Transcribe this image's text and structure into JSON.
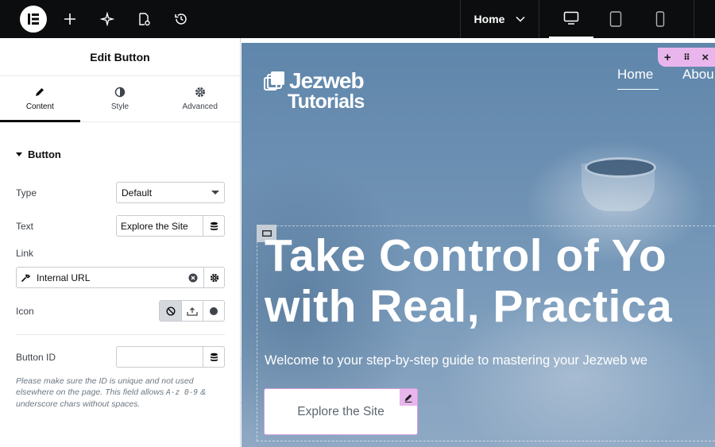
{
  "topbar": {
    "page_select": "Home",
    "icons": [
      "elementor-logo-icon",
      "add-icon",
      "ai-sparkle-icon",
      "page-settings-icon",
      "history-icon",
      "chevron-down-icon",
      "desktop-icon",
      "tablet-icon",
      "mobile-icon"
    ]
  },
  "panel": {
    "title": "Edit Button",
    "tabs": [
      {
        "label": "Content",
        "icon": "pencil-icon",
        "active": true
      },
      {
        "label": "Style",
        "icon": "half-circle-icon",
        "active": false
      },
      {
        "label": "Advanced",
        "icon": "gear-icon",
        "active": false
      }
    ],
    "section": "Button",
    "fields": {
      "type_label": "Type",
      "type_value": "Default",
      "text_label": "Text",
      "text_value": "Explore the Site",
      "link_label": "Link",
      "link_value": "Internal URL",
      "icon_label": "Icon",
      "button_id_label": "Button ID",
      "button_id_value": ""
    },
    "note_parts": [
      "Please make sure the ID is unique and not used elsewhere on the page. This field allows ",
      "A-z 0-9",
      " & underscore chars without spaces."
    ]
  },
  "preview": {
    "logo_line1": "Jezweb",
    "logo_line2": "Tutorials",
    "nav": [
      "Home",
      "Abou"
    ],
    "headline_line1": "Take Control of Yo",
    "headline_line2": "with Real, Practica",
    "subline": "Welcome to your step-by-step guide to mastering your Jezweb we",
    "cta_label": "Explore the Site"
  },
  "colors": {
    "accent_pink": "#e8b6ec",
    "topbar": "#0c0d0e",
    "hero_blue": "#6f92b4"
  }
}
